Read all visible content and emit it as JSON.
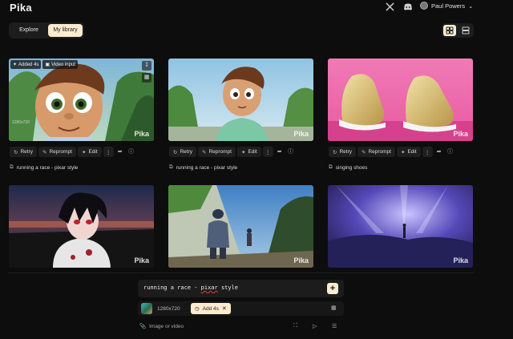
{
  "app": {
    "name": "Pika"
  },
  "header": {
    "user_name": "Paul Powers",
    "icons": [
      "x-twitter-icon",
      "discord-icon",
      "chevron-down-icon"
    ]
  },
  "nav": {
    "tabs": [
      {
        "label": "Explore",
        "active": false
      },
      {
        "label": "My library",
        "active": true
      }
    ],
    "view_modes": [
      "grid-view-icon",
      "list-view-icon"
    ]
  },
  "gallery": {
    "watermark": "Pika",
    "action_labels": {
      "retry": "Retry",
      "reprompt": "Reprompt",
      "edit": "Edit"
    },
    "cards": [
      {
        "prompt": "running a race - pixar style",
        "tags": [
          "Added 4s",
          "Video input"
        ],
        "dims": "1280x720",
        "scene": "cartoon-boy-close",
        "show_actions": true
      },
      {
        "prompt": "running a race - pixar style",
        "tags": [],
        "dims": "",
        "scene": "cartoon-boy-running",
        "show_actions": true
      },
      {
        "prompt": "singing shoes",
        "tags": [],
        "dims": "",
        "scene": "gold-shoes",
        "show_actions": true
      },
      {
        "prompt": "",
        "tags": [],
        "dims": "",
        "scene": "anime-dark-character",
        "show_actions": false
      },
      {
        "prompt": "",
        "tags": [],
        "dims": "",
        "scene": "anime-ruins",
        "show_actions": false
      },
      {
        "prompt": "",
        "tags": [],
        "dims": "",
        "scene": "anime-blue-cave",
        "show_actions": false
      }
    ]
  },
  "composer": {
    "prompt_prefix": "running a race - ",
    "prompt_misspelled": "pixar",
    "prompt_suffix": " style",
    "resolution": "1280x720",
    "chip_label": "Add 4s",
    "attach_label": "Image or video"
  },
  "colors": {
    "background": "#0d0d0d",
    "accent": "#fbeccf",
    "panel": "#1c1c1c"
  }
}
